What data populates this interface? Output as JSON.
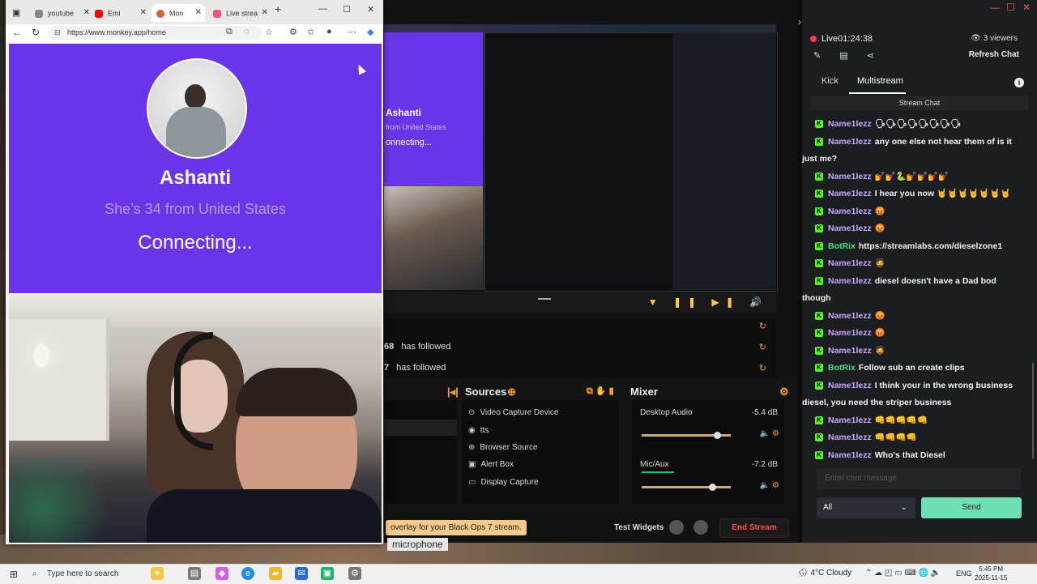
{
  "browser": {
    "tabs": [
      {
        "label": "youtube",
        "icon": "search-icon",
        "color": "#666666"
      },
      {
        "label": "Emi",
        "icon": "youtube-icon",
        "color": "#ff0000"
      },
      {
        "label": "Mon",
        "icon": "monkey-icon",
        "color": "#e0603a"
      },
      {
        "label": "Live strea",
        "icon": "kick-icon",
        "color": "#ff4f73"
      }
    ],
    "url": "https://www.monkey.app/home"
  },
  "monkey": {
    "name": "Ashanti",
    "country": "She’s 34 from United States",
    "status": "Connecting..."
  },
  "obs_preview": {
    "mini_name": "Ashanti",
    "mini_country": "from United States",
    "mini_status": "onnecting..."
  },
  "obs": {
    "events": [
      {
        "num": "68",
        "text": "has followed"
      },
      {
        "num": "7",
        "text": "has followed"
      }
    ],
    "sources_title": "Sources",
    "mixer_title": "Mixer",
    "sources": [
      {
        "icon": "video-capture-icon",
        "glyph": "⊙",
        "label": "Video Capture Device"
      },
      {
        "icon": "tts-icon",
        "glyph": "◉",
        "label": "tts"
      },
      {
        "icon": "browser-source-icon",
        "glyph": "⊕",
        "label": "Browser Source"
      },
      {
        "icon": "alert-box-icon",
        "glyph": "▣",
        "label": "Alert Box"
      },
      {
        "icon": "display-capture-icon",
        "glyph": "▭",
        "label": "Display Capture"
      }
    ],
    "mixer": [
      {
        "label": "Desktop Audio",
        "db": "-5.4 dB",
        "level": 0.85
      },
      {
        "label": "Mic/Aux",
        "db": "-7.2 dB",
        "level": 0.8
      }
    ],
    "promo": "overlay for your Black Ops 7 stream.",
    "test_widgets": "Test Widgets",
    "end_stream": "End Stream",
    "desktop_caption": "microphone"
  },
  "chat": {
    "live": "Live01:24:38",
    "viewers": "3 viewers",
    "refresh": "Refresh Chat",
    "tabs": [
      "Kick",
      "Multistream"
    ],
    "header": "Stream Chat",
    "messages": [
      {
        "user": "Name1lezz",
        "text": "🗣🗣🗣🗣🗣🗣🗣🗣",
        "color": "#c9a6ff",
        "wrap": ""
      },
      {
        "user": "Name1lezz",
        "text": "any one else not hear them of is it",
        "color": "#c9a6ff",
        "wrap": "just me?"
      },
      {
        "user": "Name1lezz",
        "text": "💅💅🐍💅💅💅💅",
        "color": "#c9a6ff",
        "wrap": ""
      },
      {
        "user": "Name1lezz",
        "text": "I hear you now 🤘🤘🤘🤘🤘🤘🤘",
        "color": "#c9a6ff",
        "wrap": ""
      },
      {
        "user": "Name1lezz",
        "text": "😡",
        "color": "#c9a6ff",
        "wrap": ""
      },
      {
        "user": "Name1lezz",
        "text": "😡",
        "color": "#c9a6ff",
        "wrap": ""
      },
      {
        "user": "BotRix",
        "text": "https://streamlabs.com/dieselzone1",
        "color": "#3fe089",
        "wrap": ""
      },
      {
        "user": "Name1lezz",
        "text": "🧔",
        "color": "#c9a6ff",
        "wrap": ""
      },
      {
        "user": "Name1lezz",
        "text": "diesel doesn't have a Dad bod",
        "color": "#c9a6ff",
        "wrap": "though"
      },
      {
        "user": "Name1lezz",
        "text": "😡",
        "color": "#c9a6ff",
        "wrap": ""
      },
      {
        "user": "Name1lezz",
        "text": "😡",
        "color": "#c9a6ff",
        "wrap": ""
      },
      {
        "user": "Name1lezz",
        "text": "🧔",
        "color": "#c9a6ff",
        "wrap": ""
      },
      {
        "user": "BotRix",
        "text": "Follow sub an create clips",
        "color": "#3fe089",
        "wrap": ""
      },
      {
        "user": "Name1lezz",
        "text": "I think your in the wrong business",
        "color": "#c9a6ff",
        "wrap": "diesel, you need the striper business"
      },
      {
        "user": "Name1lezz",
        "text": "👊👊👊👊👊",
        "color": "#c9a6ff",
        "wrap": ""
      },
      {
        "user": "Name1lezz",
        "text": "👊👊👊👊",
        "color": "#c9a6ff",
        "wrap": ""
      },
      {
        "user": "Name1lezz",
        "text": "Who's that Diesel",
        "color": "#c9a6ff",
        "wrap": ""
      }
    ],
    "input_placeholder": "Enter chat message",
    "select_value": "All",
    "send": "Send"
  },
  "taskbar": {
    "search_placeholder": "Type here to search",
    "weather": "4°C  Cloudy",
    "lang": "ENG",
    "time": "5:45 PM",
    "date": "2025-11-15"
  }
}
